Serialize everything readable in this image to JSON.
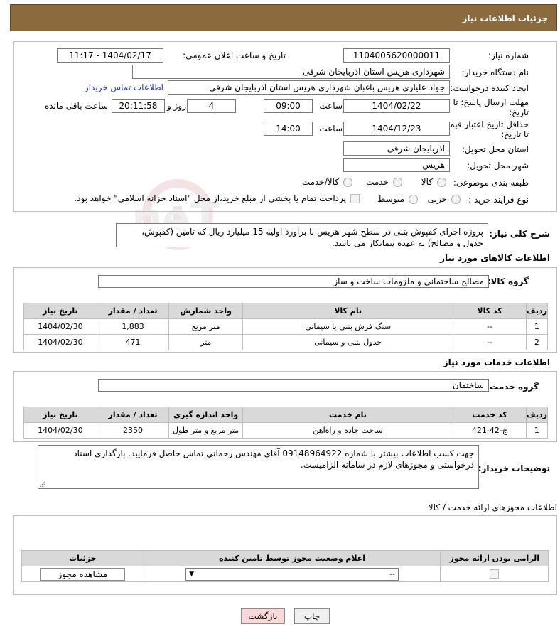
{
  "header": {
    "title": "جزئیات اطلاعات نیاز"
  },
  "form": {
    "need_no_label": "شماره نیاز:",
    "need_no": "1104005620000011",
    "announce_label": "تاریخ و ساعت اعلان عمومی:",
    "announce_value": "1404/02/17 - 11:17",
    "buyer_label": "نام دستگاه خریدار:",
    "buyer_value": "شهرداری هریس استان اذربایجان شرقی",
    "creator_label": "ایجاد کننده درخواست:",
    "creator_value": "جواد علیاری هریس باغبان شهرداری هریس استان اذربایجان شرقی",
    "contact_link": "اطلاعات تماس خریدار",
    "reply_label_1": "مهلت ارسال پاسخ: تا",
    "reply_label_2": "تاریخ:",
    "reply_date": "1404/02/22",
    "hour_label": "ساعت",
    "reply_time": "09:00",
    "days_value": "4",
    "days_label": "روز و",
    "remaining_time": "20:11:58",
    "remaining_label": "ساعت باقی مانده",
    "validity_label_1": "حداقل تاریخ اعتبار قیمت:",
    "validity_label_2": "تا تاریخ:",
    "validity_date": "1404/12/23",
    "validity_time": "14:00",
    "province_label": "استان محل تحویل:",
    "province_value": "آذربایجان شرقی",
    "city_label": "شهر محل تحویل:",
    "city_value": "هریس",
    "category_label": "طبقه بندی موضوعی:",
    "category_options": [
      "کالا",
      "خدمت",
      "کالا/خدمت"
    ],
    "process_label": "نوع فرآیند خرید :",
    "process_options": [
      "جزیی",
      "متوسط"
    ],
    "payment_note": "پرداخت تمام یا بخشی از مبلغ خرید،از محل \"اسناد خزانه اسلامی\" خواهد بود."
  },
  "description": {
    "label": "شرح کلی نیاز:",
    "text": "پروژه اجرای کفپوش بتنی در سطح شهر هریس با برآورد اولیه 15 میلیارد ریال که تامین (کفپوش، جدول و مصالح) به عهده پیمانکار می باشد."
  },
  "goods": {
    "section_title": "اطلاعات کالاهای مورد نیاز",
    "group_label": "گروه کالا:",
    "group_value": "مصالح ساختمانی و ملزومات ساخت و ساز",
    "columns": [
      "ردیف",
      "کد کالا",
      "نام کالا",
      "واحد شمارش",
      "تعداد / مقدار",
      "تاریخ نیاز"
    ],
    "rows": [
      [
        "1",
        "--",
        "سنگ فرش بتنی یا سیمانی",
        "متر مربع",
        "1,883",
        "1404/02/30"
      ],
      [
        "2",
        "--",
        "جدول بتنی و سیمانی",
        "متر",
        "471",
        "1404/02/30"
      ]
    ]
  },
  "services": {
    "section_title": "اطلاعات خدمات مورد نیاز",
    "group_label": "گروه خدمت:",
    "group_value": "ساختمان",
    "columns": [
      "ردیف",
      "کد خدمت",
      "نام خدمت",
      "واحد اندازه گیری",
      "تعداد / مقدار",
      "تاریخ نیاز"
    ],
    "rows": [
      [
        "1",
        "ج-42-421",
        "ساخت جاده و راه‌آهن",
        "متر مربع و متر طول",
        "2350",
        "1404/02/30"
      ]
    ]
  },
  "buyer_notes": {
    "label": "توضیحات خریدار:",
    "text": "جهت کسب اطلاعات بیشتر با شماره 09148964922 آقای مهندس رحمانی تماس حاصل فرمایید. بارگذاری اسناد درخواستی و مجوزهای لازم در سامانه الزامیست."
  },
  "permits": {
    "section_title": "اطلاعات مجوزهای ارائه خدمت / کالا",
    "columns": [
      "الزامی بودن ارائه مجوز",
      "اعلام وضعیت مجوز توسط تامین کننده",
      "جزئیات"
    ],
    "select_value": "--",
    "view_button": "مشاهده مجوز"
  },
  "footer": {
    "print_button": "چاپ",
    "back_button": "بازگشت"
  },
  "watermark": "AriaTender.neT"
}
